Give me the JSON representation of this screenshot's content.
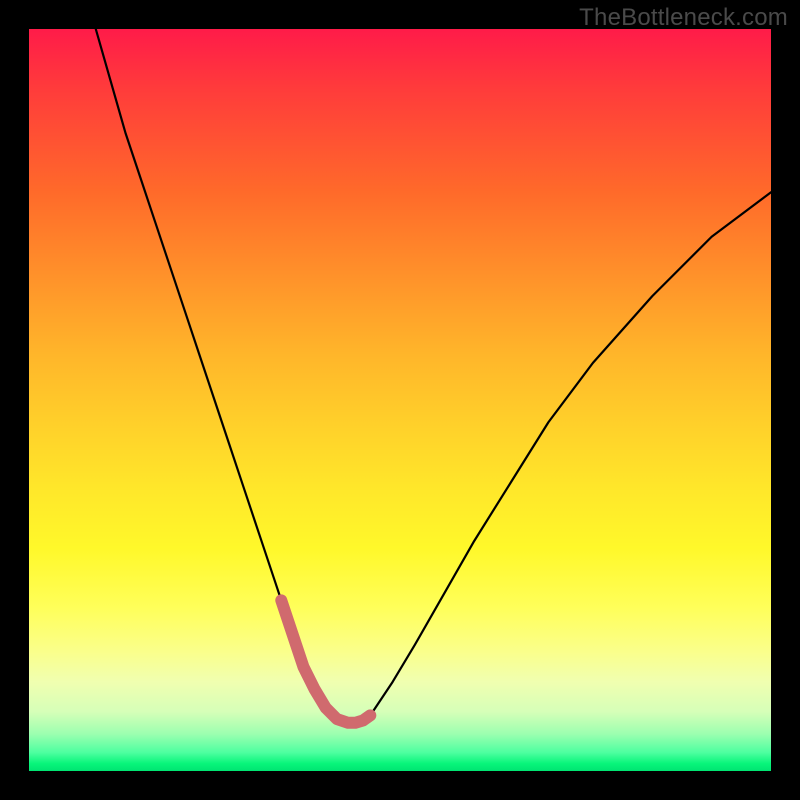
{
  "watermark": "TheBottleneck.com",
  "colors": {
    "background": "#000000",
    "curve_stroke": "#000000",
    "highlight_stroke": "#d06a6e",
    "gradient_top": "#ff1b49",
    "gradient_bottom": "#00e472"
  },
  "chart_data": {
    "type": "line",
    "title": "",
    "xlabel": "",
    "ylabel": "",
    "xlim": [
      0,
      100
    ],
    "ylim": [
      0,
      100
    ],
    "axes_visible": false,
    "grid": false,
    "series": [
      {
        "name": "bottleneck-curve",
        "x": [
          9,
          11,
          13,
          15,
          17,
          19,
          21,
          23,
          25,
          27,
          29,
          31,
          33,
          34,
          35,
          36,
          37,
          38.5,
          40,
          41.5,
          43,
          44,
          45,
          46,
          47,
          49,
          52,
          56,
          60,
          65,
          70,
          76,
          84,
          92,
          100
        ],
        "values": [
          100,
          93,
          86,
          80,
          74,
          68,
          62,
          56,
          50,
          44,
          38,
          32,
          26,
          23,
          20,
          17,
          14,
          11,
          8.5,
          7,
          6.5,
          6.5,
          6.8,
          7.5,
          9,
          12,
          17,
          24,
          31,
          39,
          47,
          55,
          64,
          72,
          78
        ]
      },
      {
        "name": "optimal-highlight",
        "x": [
          34,
          35,
          36,
          37,
          38.5,
          40,
          41.5,
          43,
          44,
          45,
          46
        ],
        "values": [
          23,
          20,
          17,
          14,
          11,
          8.5,
          7,
          6.5,
          6.5,
          6.8,
          7.5
        ]
      }
    ]
  }
}
